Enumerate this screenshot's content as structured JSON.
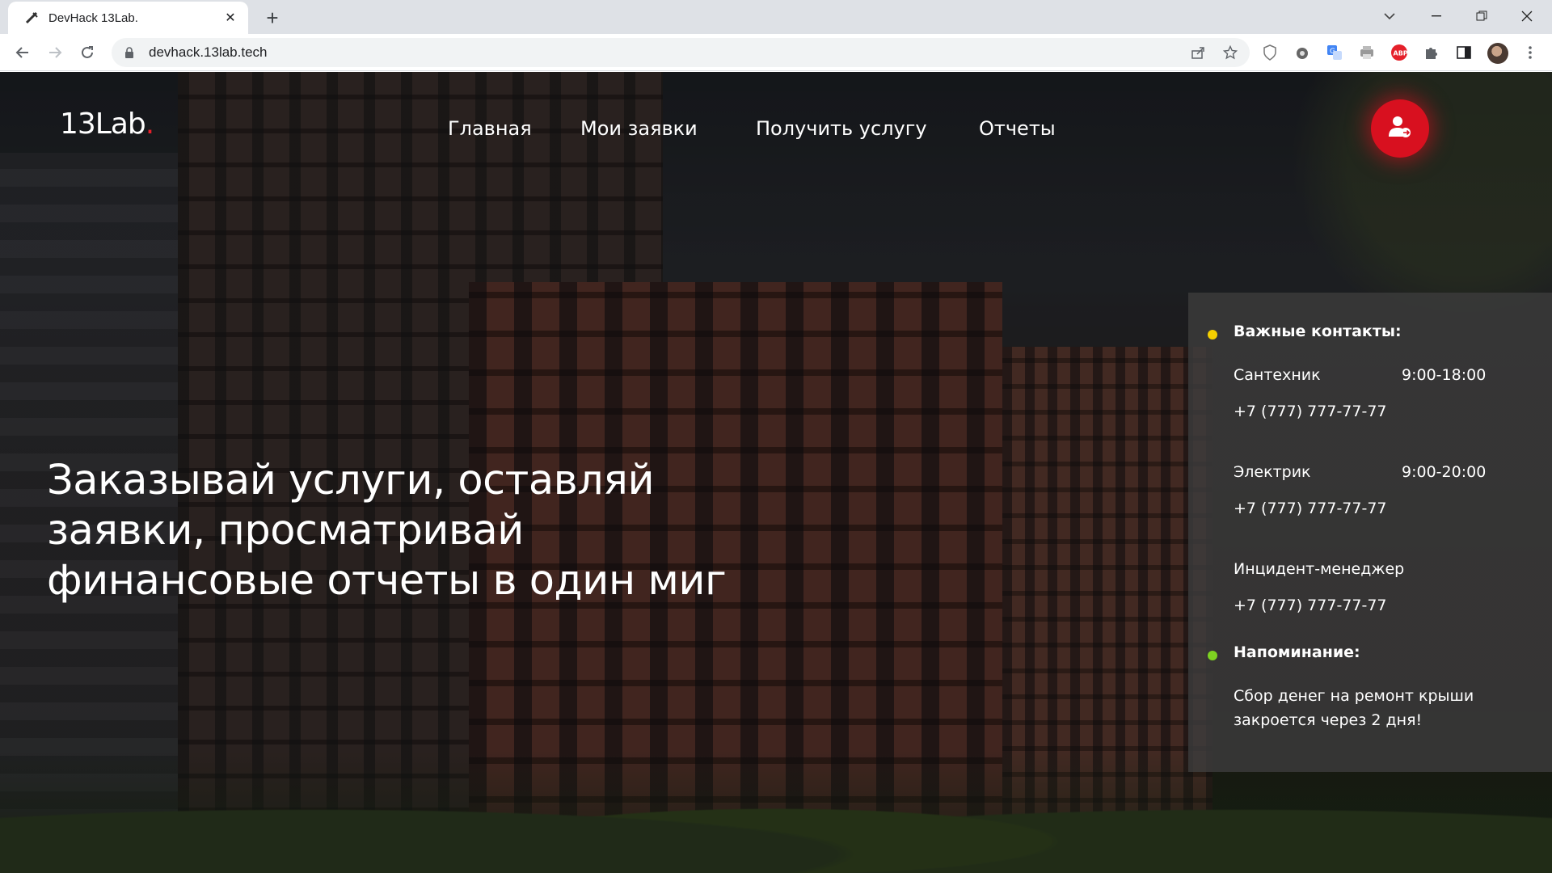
{
  "browser": {
    "tab_title": "DevHack 13Lab.",
    "url": "devhack.13lab.tech"
  },
  "site": {
    "logo": "13Lab",
    "logo_dot": ".",
    "nav": [
      "Главная",
      "Мои заявки",
      "Получить услугу",
      "Отчеты"
    ],
    "hero_lines": [
      "Заказывай услуги, оставляй",
      "заявки, просматривай",
      "финансовые отчеты в один миг"
    ],
    "contacts": {
      "heading": "Важные контакты:",
      "items": [
        {
          "role": "Сантехник",
          "hours": "9:00-18:00",
          "phone": "+7 (777) 777-77-77"
        },
        {
          "role": "Электрик",
          "hours": "9:00-20:00",
          "phone": "+7 (777) 777-77-77"
        },
        {
          "role": "Инцидент-менеджер",
          "hours": "",
          "phone": "+7 (777) 777-77-77"
        }
      ]
    },
    "reminder": {
      "heading": "Напоминание:",
      "lines": [
        "Сбор денег на ремонт крыши",
        "закроется через 2 дня!"
      ]
    }
  },
  "colors": {
    "accent_red": "#d8101f",
    "contacts_dot": "#f5d000",
    "reminder_dot": "#7ed321"
  }
}
